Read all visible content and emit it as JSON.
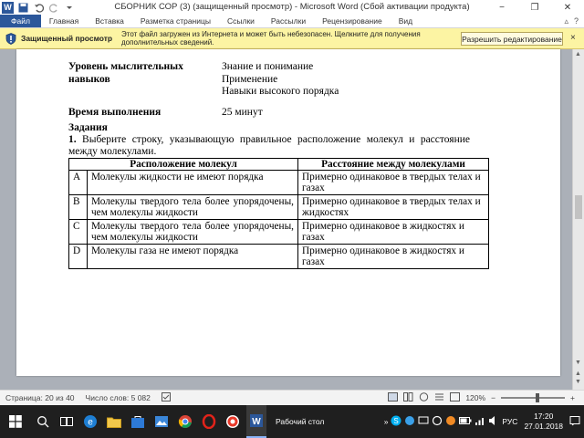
{
  "window": {
    "title": "СБОРНИК СОР (3) (защищенный просмотр)  -  Microsoft Word (Сбой активации продукта)",
    "app_logo": "W",
    "minimize": "−",
    "maximize": "❐",
    "close": "✕"
  },
  "ribbon": {
    "tabs": [
      "Файл",
      "Главная",
      "Вставка",
      "Разметка страницы",
      "Ссылки",
      "Рассылки",
      "Рецензирование",
      "Вид"
    ],
    "right_icons": [
      "▵",
      "?"
    ]
  },
  "protected_view": {
    "title": "Защищенный просмотр",
    "message": "Этот файл загружен из Интернета и может быть небезопасен. Щелкните для получения дополнительных сведений.",
    "enable_button": "Разрешить редактирование",
    "close": "×"
  },
  "document": {
    "skill_label": "Уровень мыслительных навыков",
    "skill_levels": [
      "Знание и понимание",
      "Применение",
      "Навыки высокого порядка"
    ],
    "time_label": "Время выполнения",
    "time_value": "25 минут",
    "tasks_heading": "Задания",
    "question_number": "1.",
    "question_text": "Выберите строку, указывающую правильное расположение молекул и расстояние между молекулами.",
    "table": {
      "headers": [
        "Расположение молекул",
        "Расстояние между молекулами"
      ],
      "rows": [
        {
          "letter": "A",
          "arrangement": "Молекулы жидкости не имеют порядка",
          "distance": "Примерно одинаковое в твердых телах и газах"
        },
        {
          "letter": "B",
          "arrangement": "Молекулы твердого тела более упорядочены, чем молекулы жидкости",
          "distance": "Примерно одинаковое в твердых телах и жидкостях"
        },
        {
          "letter": "C",
          "arrangement": "Молекулы твердого тела более упорядочены, чем молекулы жидкости",
          "distance": "Примерно одинаковое в жидкостях и газах"
        },
        {
          "letter": "D",
          "arrangement": "Молекулы газа не имеют порядка",
          "distance": "Примерно одинаковое в жидкостях и газах"
        }
      ]
    }
  },
  "statusbar": {
    "page": "Страница: 20 из 40",
    "words": "Число слов: 5 082",
    "zoom": "120%",
    "zoom_out": "−",
    "zoom_in": "+"
  },
  "taskbar": {
    "desktop_label": "Рабочий стол",
    "language": "РУС",
    "time": "17:20",
    "date": "27.01.2018",
    "search_glyph": "○"
  },
  "colors": {
    "word_blue": "#2b579a",
    "banner_yellow": "#fcf4a3",
    "taskbar": "#1f1f1f"
  }
}
